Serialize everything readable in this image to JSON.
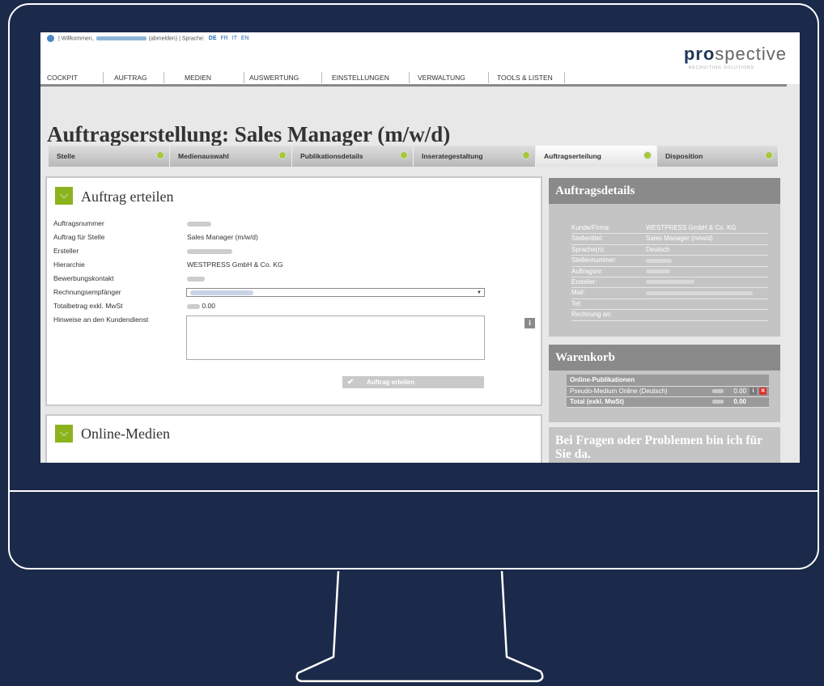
{
  "topbar": {
    "welcome_prefix": "|  Willkommen,",
    "logout": "(abmelden)",
    "language_label": "|  Sprache:",
    "languages": [
      "DE",
      "FR",
      "IT",
      "EN"
    ],
    "logo_strong": "pro",
    "logo_rest": "spective",
    "logo_sub": "RECRUITING SOLUTIONS"
  },
  "nav": [
    "COCKPIT",
    "AUFTRAG",
    "MEDIEN",
    "AUSWERTUNG",
    "EINSTELLUNGEN",
    "VERWALTUNG",
    "TOOLS & LISTEN"
  ],
  "page_title": "Auftragserstellung: Sales Manager (m/w/d)",
  "steps": [
    "Stelle",
    "Medienauswahl",
    "Publikationsdetails",
    "Inserategestaltung",
    "Auftragserteilung",
    "Disposition"
  ],
  "active_step": "Auftragserteilung",
  "order_panel": {
    "title": "Auftrag erteilen",
    "fields": {
      "auftragsnummer": "Auftragsnummer",
      "auftrag_fuer_stelle": "Auftrag für Stelle",
      "ersteller": "Ersteller",
      "hierarchie": "Hierarchie",
      "bewerbungskontakt": "Bewerbungskontakt",
      "rechnungsempfaenger": "Rechnungsempfänger",
      "totalbetrag": "Totalbetrag exkl. MwSt",
      "hinweise": "Hinweise an den Kundendienst"
    },
    "values": {
      "auftrag_fuer_stelle": "Sales Manager (m/w/d)",
      "hierarchie": "WESTPRESS GmbH & Co. KG",
      "totalbetrag": "0.00"
    },
    "submit_label": "Auftrag erteilen"
  },
  "online_panel": {
    "title": "Online-Medien"
  },
  "auftragsdetails": {
    "title": "Auftragsdetails",
    "rows": {
      "kunde_label": "Kunde/Firma:",
      "kunde_value": "WESTPRESS GmbH & Co. KG",
      "stellentitel_label": "Stellentitel:",
      "stellentitel_value": "Sales Manager (m/w/d)",
      "sprache_label": "Sprache(n):",
      "sprache_value": "Deutsch",
      "stellennummer_label": "Stellennummer:",
      "auftragsnr_label": "Auftragsnr:",
      "ersteller_label": "Ersteller:",
      "mail_label": "Mail:",
      "tel_label": "Tel:",
      "rechnung_label": "Rechnung an:"
    }
  },
  "warenkorb": {
    "title": "Warenkorb",
    "section": "Online-Publikationen",
    "item_label": "Pseudo-Medium Online (Deutsch)",
    "item_amount": "0.00",
    "total_label": "Total (exkl. MwSt)",
    "total_amount": "0.00"
  },
  "help": {
    "title": "Bei Fragen oder Problemen bin ich für Sie da."
  },
  "colors": {
    "accent_green": "#8cb31d",
    "step_dot": "#a6c83c",
    "sidebar_header": "#8a8a8a",
    "brand_navy": "#1f3658",
    "remove_red": "#d9322e"
  },
  "icons": [
    "home-icon",
    "chevron-down-icon",
    "info-icon",
    "check-icon",
    "remove-icon"
  ]
}
